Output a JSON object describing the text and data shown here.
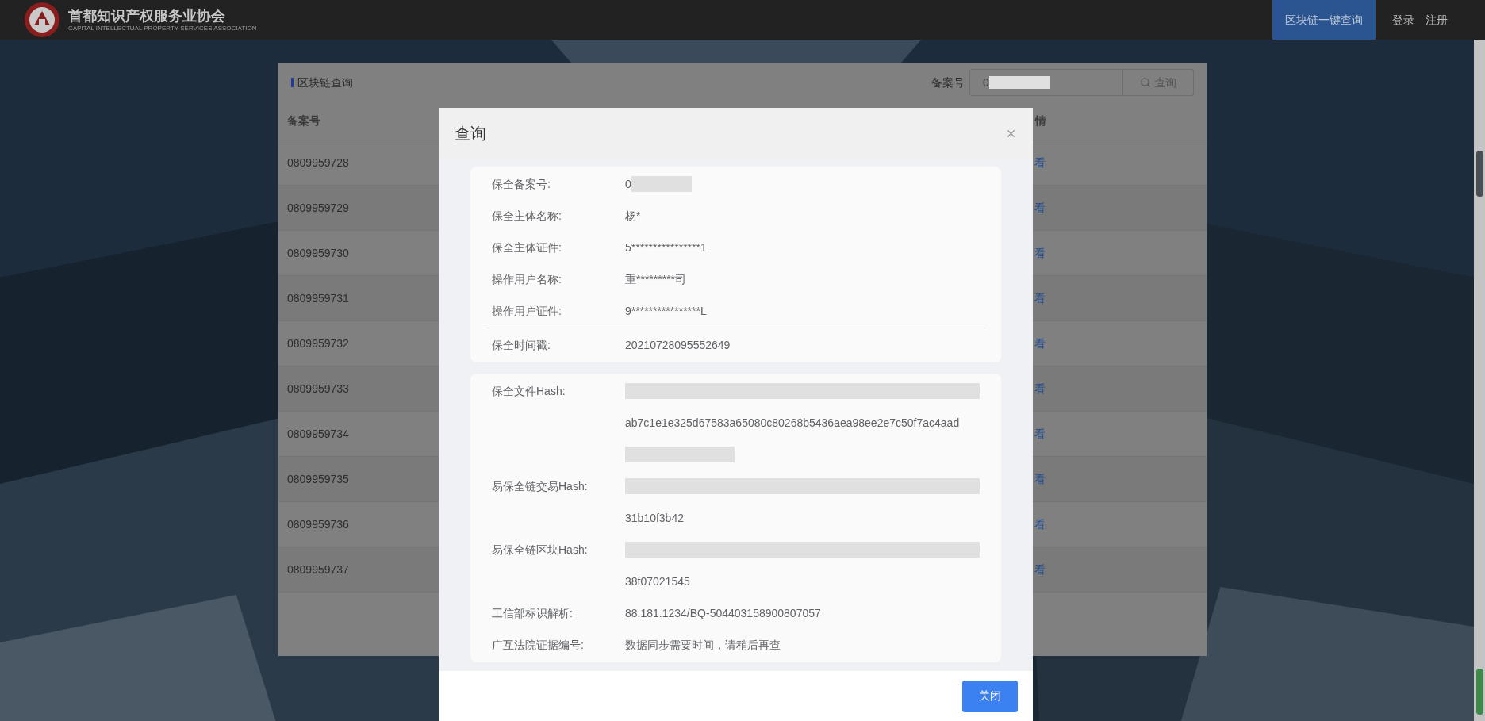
{
  "header": {
    "logo_title": "首都知识产权服务业协会",
    "logo_subtitle": "CAPITAL INTELLECTUAL PROPERTY SERVICES ASSOCIATION",
    "nav": [
      {
        "label": "区块链一键查询",
        "selected": true
      },
      {
        "label": "登录",
        "selected": false
      },
      {
        "label": "注册",
        "selected": false
      }
    ]
  },
  "panel": {
    "title": "区块链查询",
    "search": {
      "label": "备案号",
      "value": "0",
      "masked": true
    },
    "search_button": "查询",
    "table": {
      "columns": [
        "备案号",
        "情"
      ],
      "rows": [
        {
          "id": "0809959728",
          "action": "看"
        },
        {
          "id": "0809959729",
          "action": "看"
        },
        {
          "id": "0809959730",
          "action": "看"
        },
        {
          "id": "0809959731",
          "action": "看"
        },
        {
          "id": "0809959732",
          "action": "看"
        },
        {
          "id": "0809959733",
          "action": "看"
        },
        {
          "id": "0809959734",
          "action": "看"
        },
        {
          "id": "0809959735",
          "action": "看"
        },
        {
          "id": "0809959736",
          "action": "看"
        },
        {
          "id": "0809959737",
          "action": "看"
        }
      ]
    }
  },
  "modal": {
    "title": "查询",
    "sections": [
      {
        "fields": [
          {
            "label": "保全备案号:",
            "value": "0",
            "kind": "masked_after",
            "divider_before": false
          },
          {
            "label": "保全主体名称:",
            "value": "杨*",
            "kind": "plain",
            "divider_before": false
          },
          {
            "label": "保全主体证件:",
            "value": "5****************1",
            "kind": "plain",
            "divider_before": false
          },
          {
            "label": "操作用户名称:",
            "value": "重*********司",
            "kind": "plain",
            "divider_before": false
          },
          {
            "label": "操作用户证件:",
            "value": "9****************L",
            "kind": "plain",
            "divider_before": false
          },
          {
            "label": "保全时间戳:",
            "value": "20210728095552649",
            "kind": "plain",
            "divider_before": true
          }
        ]
      },
      {
        "fields": [
          {
            "label": "保全文件Hash:",
            "value": "ab7c1e1e325d67583a65080c80268b5436aea98ee2e7c50f7ac4aad",
            "kind": "masked_around",
            "divider_before": false
          },
          {
            "label": "易保全链交易Hash:",
            "value": "31b10f3b42",
            "kind": "masked_above",
            "divider_before": false
          },
          {
            "label": "易保全链区块Hash:",
            "value": "38f07021545",
            "kind": "masked_above",
            "divider_before": false
          },
          {
            "label": "工信部标识解析:",
            "value": "88.181.1234/BQ-504403158900807057",
            "kind": "plain",
            "divider_before": false
          },
          {
            "label": "广互法院证据编号:",
            "value": "数据同步需要时间，请稍后再查",
            "kind": "plain",
            "divider_before": false
          }
        ]
      }
    ],
    "close_button": "关闭"
  }
}
